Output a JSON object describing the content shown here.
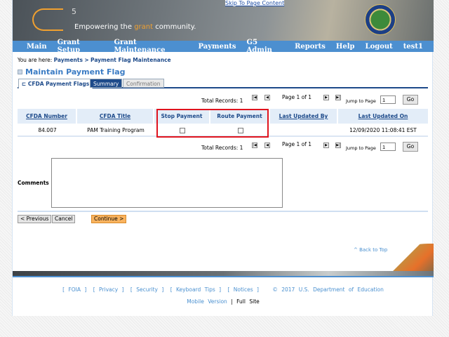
{
  "header": {
    "skip_link": "Skip To Page Content",
    "logo_number": "5",
    "tagline_pre": "Empowering the ",
    "tagline_accent": "grant",
    "tagline_post": " community."
  },
  "nav": [
    "Main",
    "Grant Setup",
    "Grant Maintenance",
    "Payments",
    "G5 Admin",
    "Reports",
    "Help",
    "Logout",
    "test1"
  ],
  "breadcrumb": {
    "prefix": "You are here: ",
    "items": [
      "Payments",
      ">",
      "Payment Flag Maintenance"
    ]
  },
  "page_title": "Maintain Payment Flag",
  "tabs": [
    "CFDA Payment Flags",
    "Summary",
    "Confirmation"
  ],
  "pager": {
    "total": "Total Records: 1",
    "page": "Page 1 of 1",
    "jump_label": "Jump to Page",
    "jump_value": "1",
    "go": "Go"
  },
  "table": {
    "headers": [
      "CFDA Number",
      "CFDA Title",
      "Stop Payment",
      "Route Payment",
      "Last Updated By",
      "Last Updated On"
    ],
    "rows": [
      {
        "cfda": "84.007",
        "title": "PAM Training Program",
        "stop": false,
        "route": false,
        "by": "",
        "on": "12/09/2020 11:08:41 EST"
      }
    ]
  },
  "comments_label": "Comments",
  "buttons": {
    "previous": "< Previous",
    "cancel": "Cancel",
    "continue": "Continue >"
  },
  "back_to_top": "^ Back to Top",
  "footer": {
    "links": [
      "[ FOIA ]",
      "[ Privacy ]",
      "[ Security ]",
      "[ Keyboard Tips ]",
      "[ Notices ]"
    ],
    "copyright": "© 2017 U.S. Department of Education",
    "mobile": "Mobile Version",
    "sep": "|",
    "full": "Full Site"
  },
  "colors": {
    "nav": "#4c8fd0",
    "accent": "#f0a030",
    "highlight": "#e0141e",
    "continue": "#f9b35f"
  }
}
